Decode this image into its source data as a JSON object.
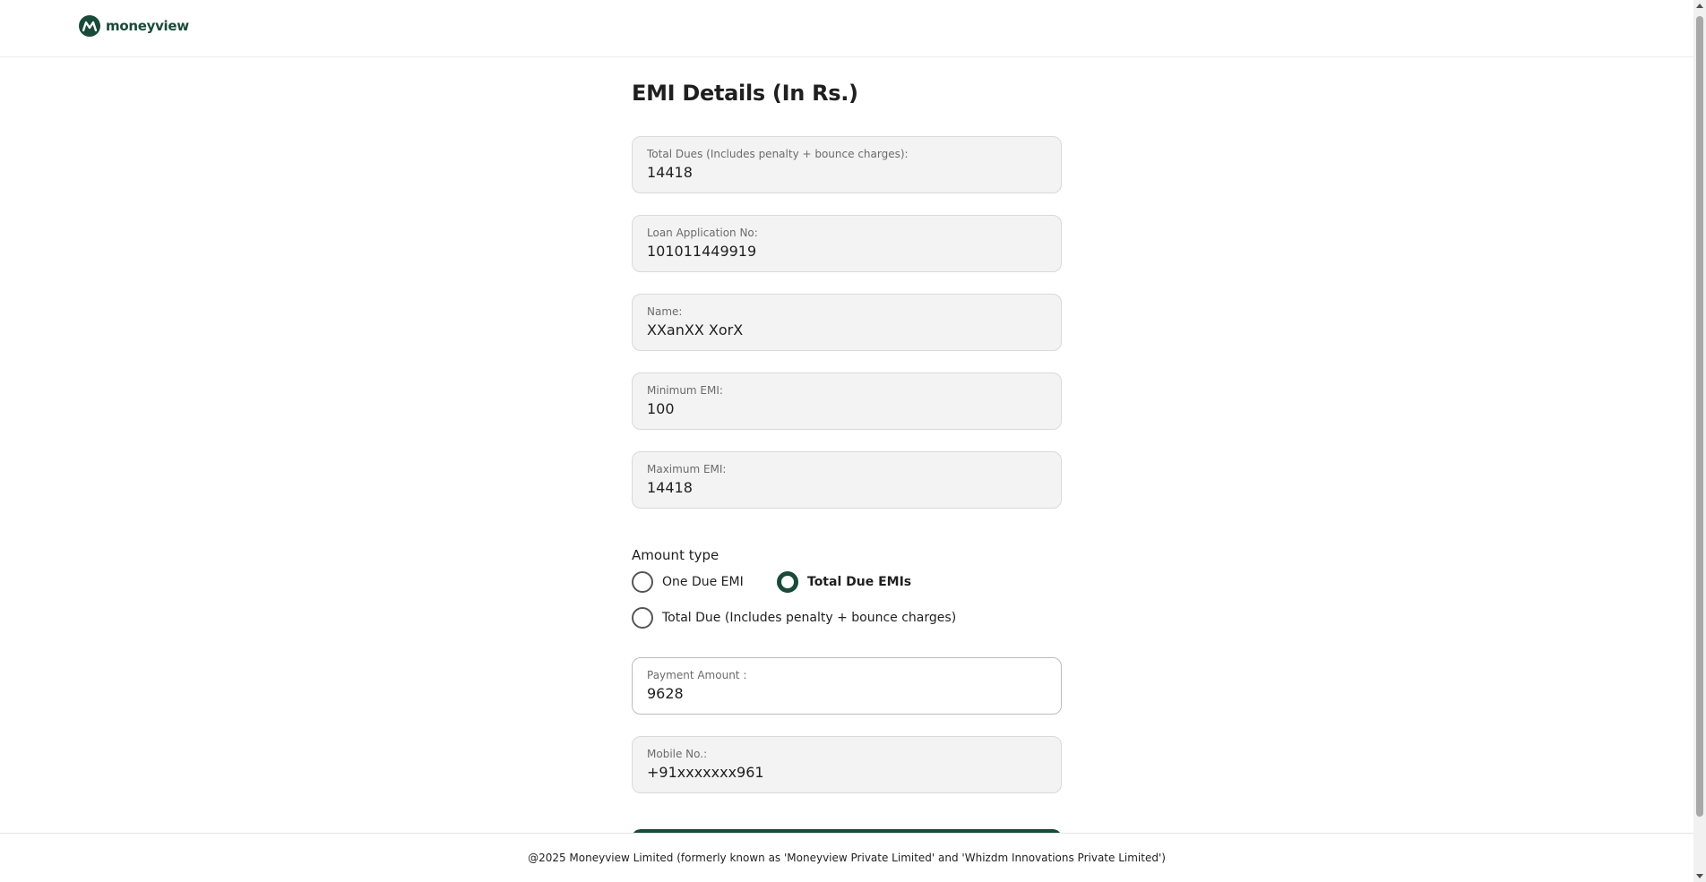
{
  "brand": {
    "name": "moneyview",
    "color": "#1a4a3a"
  },
  "page": {
    "title": "EMI Details (In Rs.)"
  },
  "fields": {
    "total_dues": {
      "label": "Total Dues (Includes penalty + bounce charges):",
      "value": "14418"
    },
    "loan_application_no": {
      "label": "Loan Application No:",
      "value": "101011449919"
    },
    "name": {
      "label": "Name:",
      "value": "XXanXX XorX"
    },
    "minimum_emi": {
      "label": "Minimum EMI:",
      "value": "100"
    },
    "maximum_emi": {
      "label": "Maximum EMI:",
      "value": "14418"
    },
    "payment_amount": {
      "label": "Payment Amount :",
      "value": "9628"
    },
    "mobile_no": {
      "label": "Mobile No.:",
      "value": "+91xxxxxxx961"
    }
  },
  "amount_type": {
    "label": "Amount type",
    "options": [
      {
        "label": "One Due EMI",
        "selected": false
      },
      {
        "label": "Total Due EMIs",
        "selected": true
      },
      {
        "label": "Total Due (Includes penalty + bounce charges)",
        "selected": false
      }
    ]
  },
  "footer": {
    "text": "@2025 Moneyview Limited (formerly known as 'Moneyview Private Limited' and 'Whizdm Innovations Private Limited')"
  }
}
